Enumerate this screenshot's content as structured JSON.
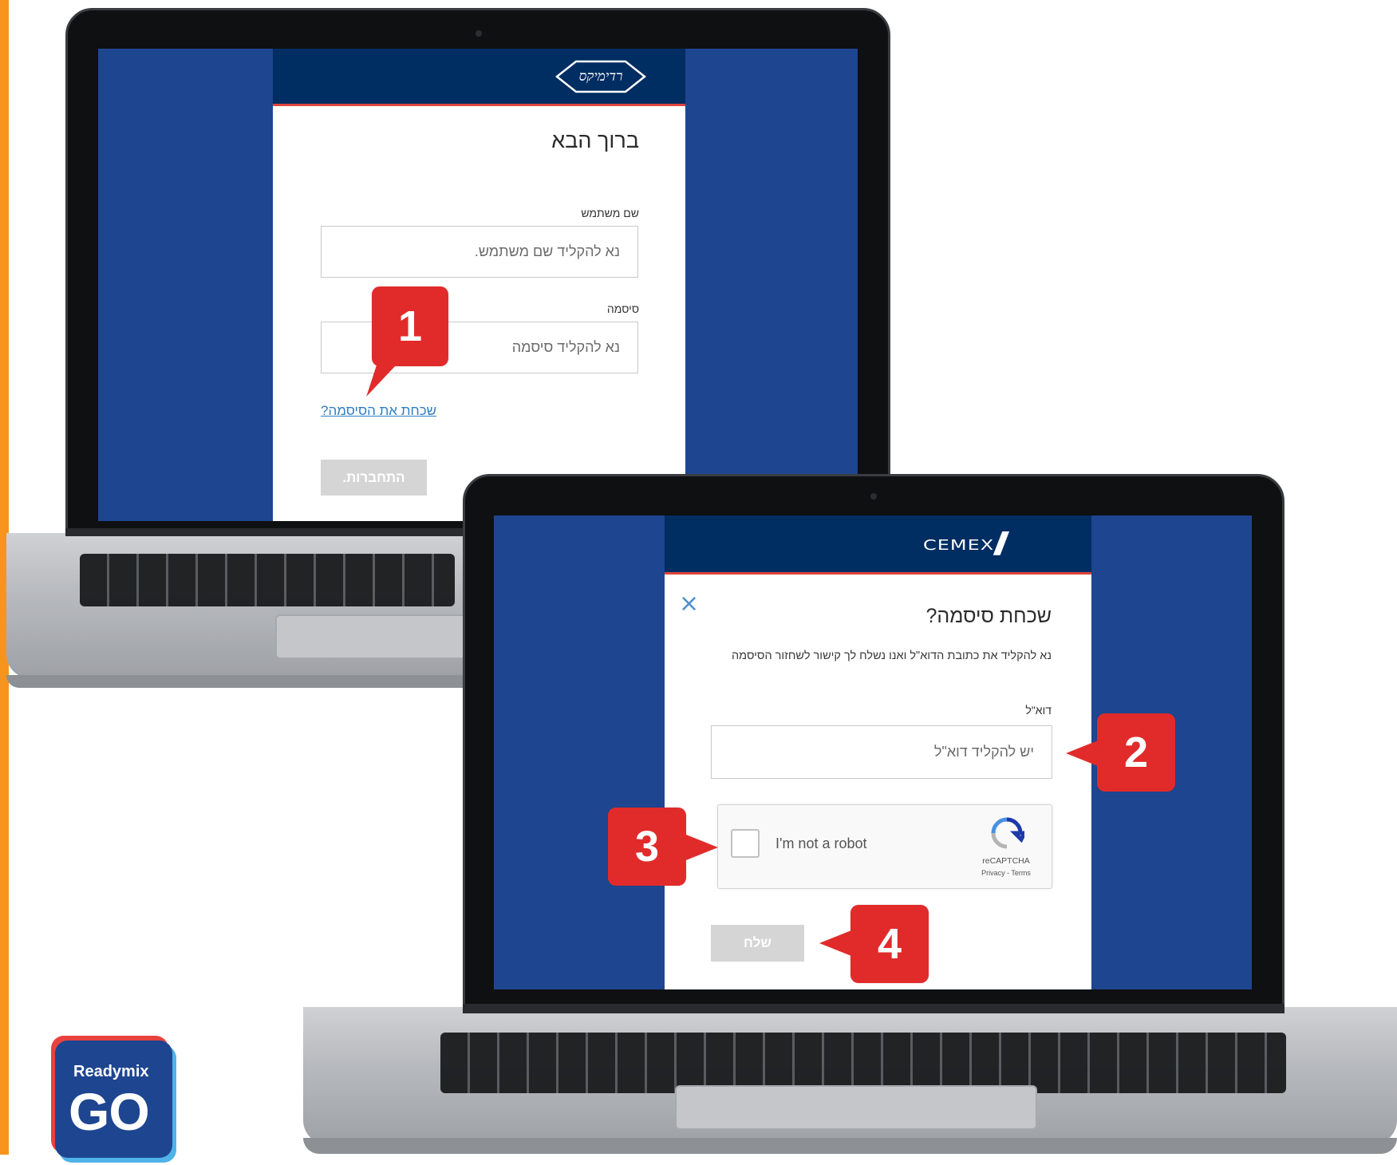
{
  "colors": {
    "accent_orange": "#f7941d",
    "screen_blue": "#1e4590",
    "header_navy": "#002d62",
    "header_underline": "#e0443d",
    "link_blue": "#2f7ec2",
    "callout_red": "#e12b2b"
  },
  "login_screen": {
    "logo_text": "רדימיקס",
    "welcome_title": "ברוך הבא",
    "username_label": "שם משתמש",
    "username_placeholder": "נא להקליד שם משתמש.",
    "password_label": "סיסמה",
    "password_placeholder": "נא להקליד סיסמה",
    "forgot_link": "שכחת את הסיסמה?",
    "login_button": "התחברות."
  },
  "forgot_screen": {
    "logo_slashes": "//",
    "logo_text": "CEMEX",
    "close_icon": "×",
    "title": "שכחת סיסמה?",
    "description": "נא להקליד את כתובת הדוא\"ל ואנו נשלח לך קישור לשחזור הסיסמה",
    "email_label": "דוא\"ל",
    "email_placeholder": "יש להקליד דוא\"ל",
    "captcha_label": "I'm not a robot",
    "captcha_brand": "reCAPTCHA",
    "captcha_links": "Privacy - Terms",
    "send_button": "שלח"
  },
  "callouts": [
    "1",
    "2",
    "3",
    "4"
  ],
  "badge": {
    "small_text": "Readymix",
    "big_text": "GO"
  }
}
